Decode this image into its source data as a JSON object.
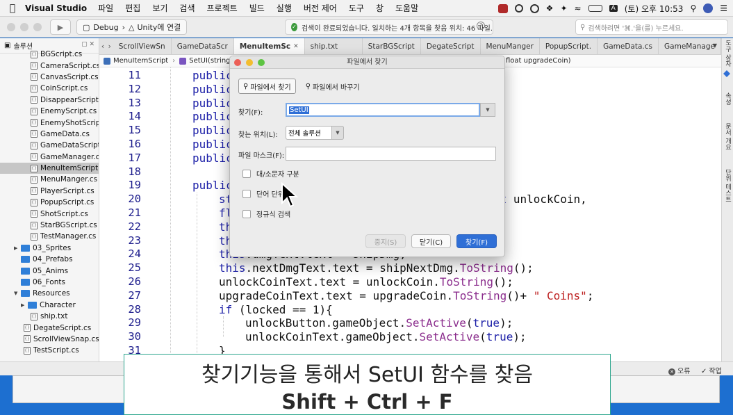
{
  "menubar": {
    "app_name": "Visual Studio",
    "items": [
      "파일",
      "편집",
      "보기",
      "검색",
      "프로젝트",
      "빌드",
      "실행",
      "버전 제어",
      "도구",
      "창",
      "도움말"
    ],
    "clock": "(토) 오후 10:53",
    "input_indicator": "A"
  },
  "toolbar": {
    "config": "Debug",
    "target": "Unity에 연결",
    "status": "검색이 완료되었습니다. 일치하는 4개 항목을 찾음 위치: 46 파일.",
    "search_placeholder": "검색하려면 '⌘.'을(를) 누르세요."
  },
  "sidebar": {
    "title": "솔루션",
    "items": [
      {
        "type": "file",
        "label": "BGScript.cs",
        "indent": 1
      },
      {
        "type": "file",
        "label": "CameraScript.cs",
        "indent": 1
      },
      {
        "type": "file",
        "label": "CanvasScript.cs",
        "indent": 1
      },
      {
        "type": "file",
        "label": "CoinScript.cs",
        "indent": 1
      },
      {
        "type": "file",
        "label": "DisappearScript.cs",
        "indent": 1
      },
      {
        "type": "file",
        "label": "EnemyScript.cs",
        "indent": 1
      },
      {
        "type": "file",
        "label": "EnemyShotScript.cs",
        "indent": 1
      },
      {
        "type": "file",
        "label": "GameData.cs",
        "indent": 1
      },
      {
        "type": "file",
        "label": "GameDataScript.cs",
        "indent": 1
      },
      {
        "type": "file",
        "label": "GameManager.cs",
        "indent": 1
      },
      {
        "type": "file",
        "label": "MenuItemScript.cs",
        "indent": 1,
        "selected": true
      },
      {
        "type": "file",
        "label": "MenuManger.cs",
        "indent": 1
      },
      {
        "type": "file",
        "label": "PlayerScript.cs",
        "indent": 1
      },
      {
        "type": "file",
        "label": "PopupScript.cs",
        "indent": 1
      },
      {
        "type": "file",
        "label": "ShotScript.cs",
        "indent": 1
      },
      {
        "type": "file",
        "label": "StarBGScript.cs",
        "indent": 1
      },
      {
        "type": "file",
        "label": "TestManager.cs",
        "indent": 1
      },
      {
        "type": "folder",
        "label": "03_Sprites",
        "indent": 0,
        "expanded": false
      },
      {
        "type": "folder",
        "label": "04_Prefabs",
        "indent": 0
      },
      {
        "type": "folder",
        "label": "05_Anims",
        "indent": 0
      },
      {
        "type": "folder",
        "label": "06_Fonts",
        "indent": 0
      },
      {
        "type": "folder",
        "label": "Resources",
        "indent": 0,
        "expanded": true
      },
      {
        "type": "folder",
        "label": "Character",
        "indent": 1,
        "expanded": false
      },
      {
        "type": "file",
        "label": "ship.txt",
        "indent": 1
      },
      {
        "type": "file",
        "label": "DegateScript.cs",
        "indent": 0
      },
      {
        "type": "file",
        "label": "ScrollViewSnap.cs",
        "indent": 0
      },
      {
        "type": "file",
        "label": "TestScript.cs",
        "indent": 0
      }
    ]
  },
  "tabs": [
    {
      "label": "ScrollViewSn"
    },
    {
      "label": "GameDataScr"
    },
    {
      "label": "MenuItemSc",
      "active": true
    },
    {
      "label": "ship.txt"
    },
    {
      "label": "StarBGScript"
    },
    {
      "label": "DegateScript"
    },
    {
      "label": "MenuManger"
    },
    {
      "label": "PopupScript."
    },
    {
      "label": "GameData.cs"
    },
    {
      "label": "GameManage"
    }
  ],
  "breadcrumb": {
    "class": "MenuItemScript",
    "method": "SetUI(string s",
    "method_tail": "float upgradeCoin)"
  },
  "code_lines": [
    {
      "n": "11",
      "indent": 1,
      "parts": [
        [
          "kw",
          "public"
        ]
      ]
    },
    {
      "n": "12",
      "indent": 1,
      "parts": [
        [
          "kw",
          "public"
        ]
      ]
    },
    {
      "n": "13",
      "indent": 1,
      "parts": [
        [
          "kw",
          "public"
        ]
      ]
    },
    {
      "n": "14",
      "indent": 1,
      "parts": [
        [
          "kw",
          "public"
        ]
      ]
    },
    {
      "n": "15",
      "indent": 1,
      "parts": [
        [
          "kw",
          "public"
        ]
      ]
    },
    {
      "n": "16",
      "indent": 1,
      "parts": [
        [
          "kw",
          "public"
        ]
      ]
    },
    {
      "n": "17",
      "indent": 1,
      "parts": [
        [
          "kw",
          "public"
        ]
      ]
    },
    {
      "n": "18",
      "indent": 0,
      "parts": []
    },
    {
      "n": "19",
      "indent": 1,
      "parts": [
        [
          "kw",
          "public"
        ],
        [
          "p",
          "                                    evel,"
        ]
      ]
    },
    {
      "n": "20",
      "indent": 2,
      "parts": [
        [
          "kw",
          "st"
        ],
        [
          "p",
          "                              cked, "
        ],
        [
          "kw",
          "float"
        ],
        [
          "p",
          " unlockCoin,"
        ]
      ]
    },
    {
      "n": "21",
      "indent": 2,
      "parts": [
        [
          "kw",
          "fl"
        ]
      ]
    },
    {
      "n": "22",
      "indent": 2,
      "parts": [
        [
          "kw",
          "th"
        ]
      ]
    },
    {
      "n": "23",
      "indent": 2,
      "parts": [
        [
          "kw",
          "th"
        ]
      ]
    },
    {
      "n": "24",
      "indent": 2,
      "parts": [
        [
          "kw",
          "this"
        ],
        [
          "p",
          ".dmgText.text = shipDmg;"
        ]
      ]
    },
    {
      "n": "25",
      "indent": 2,
      "parts": [
        [
          "kw",
          "this"
        ],
        [
          "p",
          ".nextDmgText.text = shipNextDmg."
        ],
        [
          "fn",
          "ToString"
        ],
        [
          "p",
          "();"
        ]
      ]
    },
    {
      "n": "26",
      "indent": 2,
      "parts": [
        [
          "p",
          "unlockCoinText.text = unlockCoin."
        ],
        [
          "fn",
          "ToString"
        ],
        [
          "p",
          "();"
        ]
      ]
    },
    {
      "n": "27",
      "indent": 2,
      "parts": [
        [
          "p",
          "upgradeCoinText.text = upgradeCoin."
        ],
        [
          "fn",
          "ToString"
        ],
        [
          "p",
          "()+ "
        ],
        [
          "str",
          "\" Coins\""
        ],
        [
          "p",
          ";"
        ]
      ]
    },
    {
      "n": "28",
      "indent": 2,
      "parts": [
        [
          "kw",
          "if"
        ],
        [
          "p",
          " (locked == 1){"
        ]
      ]
    },
    {
      "n": "29",
      "indent": 3,
      "parts": [
        [
          "p",
          "unlockButton.gameObject."
        ],
        [
          "fn",
          "SetActive"
        ],
        [
          "p",
          "("
        ],
        [
          "kw",
          "true"
        ],
        [
          "p",
          ");"
        ]
      ]
    },
    {
      "n": "30",
      "indent": 3,
      "parts": [
        [
          "p",
          "unlockCoinText.gameObject."
        ],
        [
          "fn",
          "SetActive"
        ],
        [
          "p",
          "("
        ],
        [
          "kw",
          "true"
        ],
        [
          "p",
          ");"
        ]
      ]
    },
    {
      "n": "31",
      "indent": 2,
      "parts": [
        [
          "p",
          "}"
        ]
      ]
    }
  ],
  "dialog": {
    "title": "파일에서 찾기",
    "tab_find": "파일에서 찾기",
    "tab_replace": "파일에서 바꾸기",
    "find_label": "찾기(F):",
    "find_value": "SetUI",
    "scope_label": "찾는 위치(L):",
    "scope_value": "전체 솔루션",
    "mask_label": "파일 마스크(F):",
    "mask_value": "",
    "opt_case": "대/소문자 구분",
    "opt_word": "단어 단위로",
    "opt_regex": "정규식 검색",
    "btn_stop": "중지(S)",
    "btn_close": "닫기(C)",
    "btn_find": "찾기(F)"
  },
  "right_panel": [
    "도구 상자",
    "속성",
    "문서 개요",
    "단위 테스트"
  ],
  "bottom_status": {
    "errors": "오류",
    "tasks": "작업"
  },
  "subtitle": {
    "line1": "찾기기능을 통해서 SetUI 함수를 찾음",
    "line2": "Shift + Ctrl + F"
  },
  "colors": {
    "accent": "#2f6fd6",
    "keyword": "#1d20a8",
    "method": "#8a2c8c",
    "string": "#bd2020",
    "subtitle_border": "#2aa58c"
  }
}
